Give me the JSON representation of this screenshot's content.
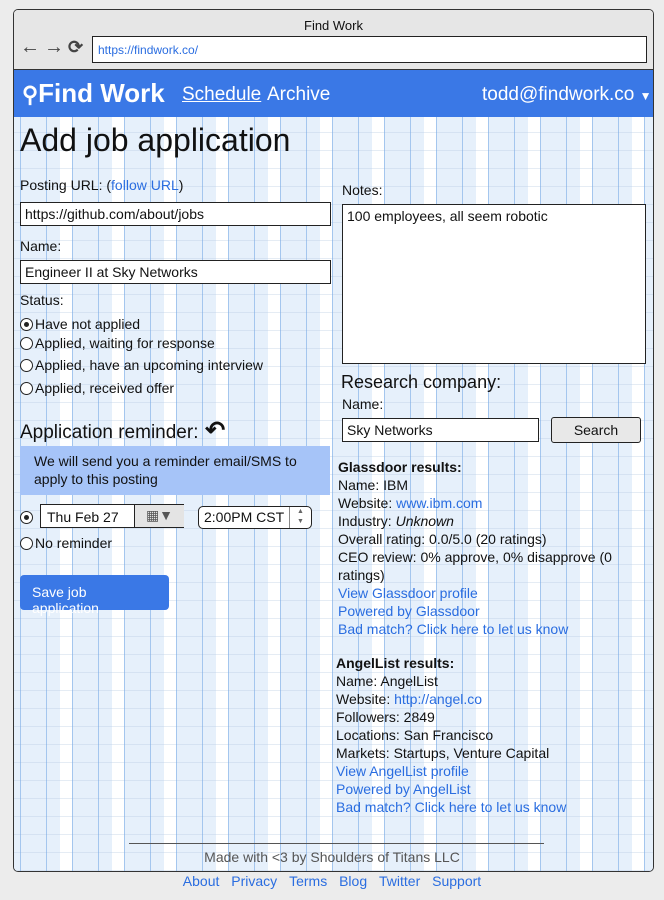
{
  "browser": {
    "title": "Find Work",
    "url": "https://findwork.co/"
  },
  "nav": {
    "brand": "Find Work",
    "links": [
      "Schedule",
      "Archive"
    ],
    "user": "todd@findwork.co"
  },
  "form": {
    "title": "Add job application",
    "posting_url_label": "Posting URL: (",
    "follow_url": "follow URL",
    "close_paren": ")",
    "posting_url": "https://github.com/about/jobs",
    "name_label": "Name:",
    "name": "Engineer II at Sky Networks",
    "status_label": "Status:",
    "status_options": [
      "Have not applied",
      "Applied, waiting for response",
      "Applied, have an upcoming interview",
      "Applied, received offer"
    ],
    "status_selected": 0,
    "reminder_title": "Application reminder:",
    "reminder_notice": "We will send you a reminder email/SMS to apply to this posting",
    "reminder_date": "Thu Feb 27",
    "reminder_time": "2:00PM CST",
    "no_reminder": "No reminder",
    "save": "Save job application",
    "notes_label": "Notes:",
    "notes": "100 employees, all seem robotic"
  },
  "research": {
    "title": "Research company:",
    "name_label": "Name:",
    "name": "Sky Networks",
    "search": "Search",
    "glassdoor": {
      "heading": "Glassdoor results:",
      "name": "Name: IBM",
      "website_label": "Website: ",
      "website": "www.ibm.com",
      "industry_label": "Industry: ",
      "industry": "Unknown",
      "rating": "Overall rating: 0.0/5.0 (20 ratings)",
      "ceo": "CEO review: 0% approve, 0% disapprove (0 ratings)",
      "links": [
        "View Glassdoor profile",
        "Powered by Glassdoor",
        "Bad match? Click here to let us know"
      ]
    },
    "angellist": {
      "heading": "AngelList results:",
      "name": "Name: AngelList",
      "website_label": "Website: ",
      "website": "http://angel.co",
      "followers": "Followers: 2849",
      "locations": "Locations: San Francisco",
      "markets": "Markets: Startups, Venture Capital",
      "links": [
        "View AngelList profile",
        "Powered by AngelList",
        "Bad match? Click here to let us know"
      ]
    }
  },
  "footer": {
    "credit": "Made with <3 by Shoulders of Titans LLC",
    "links": [
      "About",
      "Privacy",
      "Terms",
      "Blog",
      "Twitter",
      "Support"
    ]
  },
  "colors": {
    "brand": "#3a78e6",
    "link": "#2a6de0",
    "notice": "#a6c4f8"
  }
}
